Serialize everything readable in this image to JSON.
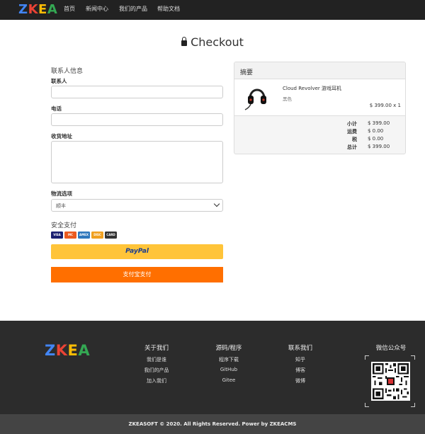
{
  "navbar": {
    "logo": [
      "Z",
      "K",
      "E",
      "A"
    ],
    "logo_colors": [
      "#4285f4",
      "#ea4335",
      "#fbbc05",
      "#34a853"
    ],
    "items": [
      "首页",
      "新闻中心",
      "我们的产品",
      "帮助文档"
    ]
  },
  "page": {
    "title": "Checkout"
  },
  "form": {
    "contact_heading": "联系人信息",
    "contact_label": "联系人",
    "phone_label": "电话",
    "address_label": "收货地址",
    "shipping_label": "物流选项",
    "shipping_value": "顺丰",
    "payment_heading": "安全支付",
    "cards": [
      "VISA",
      "MC",
      "AMEX",
      "DISC",
      "CARD"
    ],
    "paypal_label": "PayPal",
    "alipay_label": "支付宝支付"
  },
  "summary": {
    "heading": "摘要",
    "product_name": "Cloud Revolver 游戏耳机",
    "product_variant": "黑色",
    "product_price": "$ 399.00 x 1",
    "totals": [
      {
        "label": "小计",
        "value": "$ 399.00"
      },
      {
        "label": "运费",
        "value": "$ 0.00"
      },
      {
        "label": "税",
        "value": "$ 0.00"
      },
      {
        "label": "总计",
        "value": "$ 399.00"
      }
    ]
  },
  "footer": {
    "logo": [
      "Z",
      "K",
      "E",
      "A"
    ],
    "columns": [
      {
        "title": "关于我们",
        "links": [
          "我们是谁",
          "我们的产品",
          "加入我们"
        ]
      },
      {
        "title": "源码/程序",
        "links": [
          "程序下载",
          "GitHub",
          "Gitee"
        ]
      },
      {
        "title": "联系我们",
        "links": [
          "知乎",
          "博客",
          "微博"
        ]
      }
    ],
    "qr_title": "微信公众号",
    "copyright": "ZKEASOFT © 2020. All Rights Reserved. Power by ZKEACMS"
  }
}
